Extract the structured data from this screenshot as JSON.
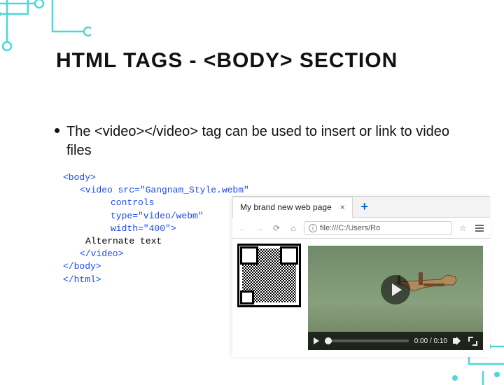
{
  "slide": {
    "title": "HTML TAGS - <BODY> SECTION",
    "bullet": "The <video></video> tag can be used to insert or link to video files"
  },
  "code": {
    "body_open": "<body>",
    "video_open": "<video ",
    "attr_src": "src=\"Gangnam_Style.webm\"",
    "attr_controls": "controls",
    "attr_type": "type=\"video/webm\"",
    "attr_width": "width=\"400\">",
    "alt_text": "Alternate text",
    "video_close": "</video>",
    "body_close": "</body>",
    "html_close": "</html>"
  },
  "browser": {
    "tab_title": "My brand new web page",
    "tab_close": "×",
    "new_tab": "+",
    "back": "←",
    "forward": "→",
    "reload": "⟳",
    "home": "⌂",
    "url_info": "i",
    "url": "file:///C:/Users/Ro",
    "star": "☆",
    "time_current": "0:00",
    "time_sep": " / ",
    "time_total": "0:10"
  }
}
